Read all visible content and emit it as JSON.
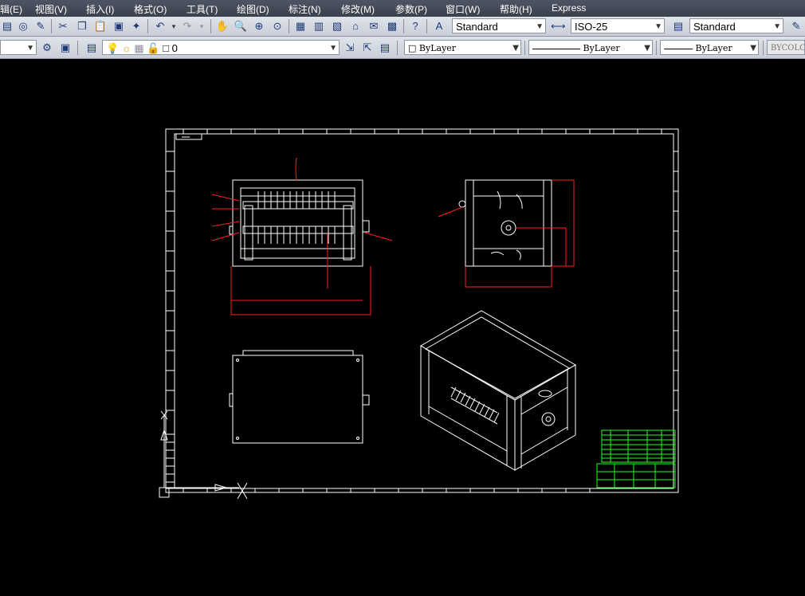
{
  "menu": {
    "items": [
      "辑(E)",
      "视图(V)",
      "插入(I)",
      "格式(O)",
      "工具(T)",
      "绘图(D)",
      "标注(N)",
      "修改(M)",
      "参数(P)",
      "窗口(W)",
      "帮助(H)",
      "Express"
    ]
  },
  "toolbar1": {
    "text_style": "Standard",
    "dim_style": "ISO-25",
    "table_style": "Standard"
  },
  "toolbar2": {
    "layer_value": "0",
    "color_value": "ByLayer",
    "linetype_value": "ByLayer",
    "lineweight_value": "ByLayer",
    "plotstyle_value": "BYCOLOR"
  },
  "colors": {
    "background": "#000000",
    "geometry": "#ffffff",
    "dimension": "#ff2020",
    "titleblock": "#20ff20"
  }
}
